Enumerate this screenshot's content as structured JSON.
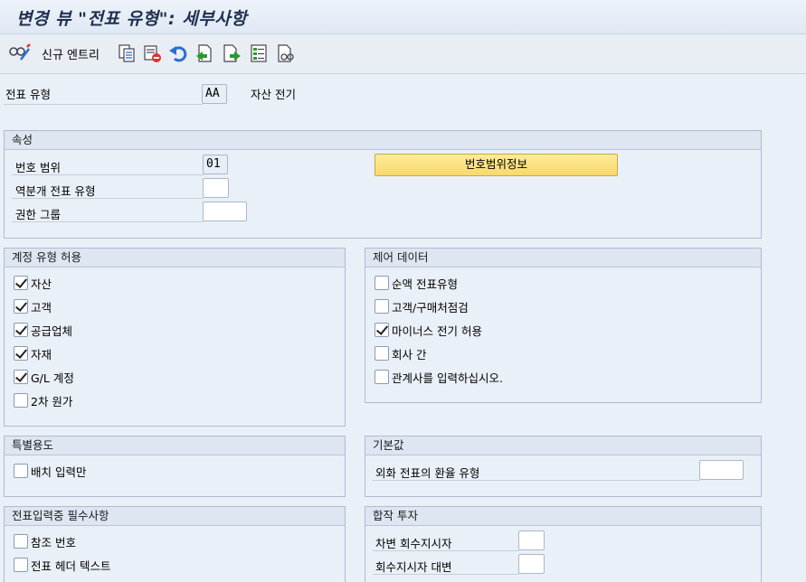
{
  "title": "변경 뷰 \"전표 유형\": 세부사항",
  "toolbar": {
    "new_entries_label": "신규 엔트리",
    "icons": [
      "glasses-pencil-icon",
      "copy-icon",
      "delete-icon",
      "undo-icon",
      "previous-entry-icon",
      "next-entry-icon",
      "select-all-icon",
      "other-view-icon"
    ]
  },
  "doc_type": {
    "label": "전표 유형",
    "value": "AA",
    "description": "자산 전기"
  },
  "attributes": {
    "header": "속성",
    "number_range_label": "번호 범위",
    "number_range_value": "01",
    "reverse_doc_type_label": "역분개 전표 유형",
    "reverse_doc_type_value": "",
    "auth_group_label": "권한 그룹",
    "auth_group_value": "",
    "number_range_info_button": "번호범위정보"
  },
  "account_types": {
    "header": "계정 유형 허용",
    "items": [
      {
        "label": "자산",
        "checked": true
      },
      {
        "label": "고객",
        "checked": true
      },
      {
        "label": "공급업체",
        "checked": true
      },
      {
        "label": "자재",
        "checked": true
      },
      {
        "label": "G/L 계정",
        "checked": true
      },
      {
        "label": "2차 원가",
        "checked": false
      }
    ]
  },
  "control_data": {
    "header": "제어 데이터",
    "items": [
      {
        "label": "순액 전표유형",
        "checked": false
      },
      {
        "label": "고객/구매처점검",
        "checked": false
      },
      {
        "label": "마이너스 전기 허용",
        "checked": true
      },
      {
        "label": "회사 간",
        "checked": false
      },
      {
        "label": "관계사를 입력하십시오.",
        "checked": false
      }
    ]
  },
  "special_usage": {
    "header": "특별용도",
    "items": [
      {
        "label": "배치 입력만",
        "checked": false
      }
    ]
  },
  "default_values": {
    "header": "기본값",
    "fx_rate_type_label": "외화 전표의 환율 유형",
    "fx_rate_type_value": ""
  },
  "required_fields": {
    "header": "전표입력중 필수사항",
    "items": [
      {
        "label": "참조 번호",
        "checked": false
      },
      {
        "label": "전표 헤더 텍스트",
        "checked": false
      }
    ]
  },
  "joint_venture": {
    "header": "합작 투자",
    "debit_recovery_label": "차변 회수지시자",
    "debit_recovery_value": "",
    "recovery_credit_label": "회수지시자 대변",
    "recovery_credit_value": ""
  }
}
